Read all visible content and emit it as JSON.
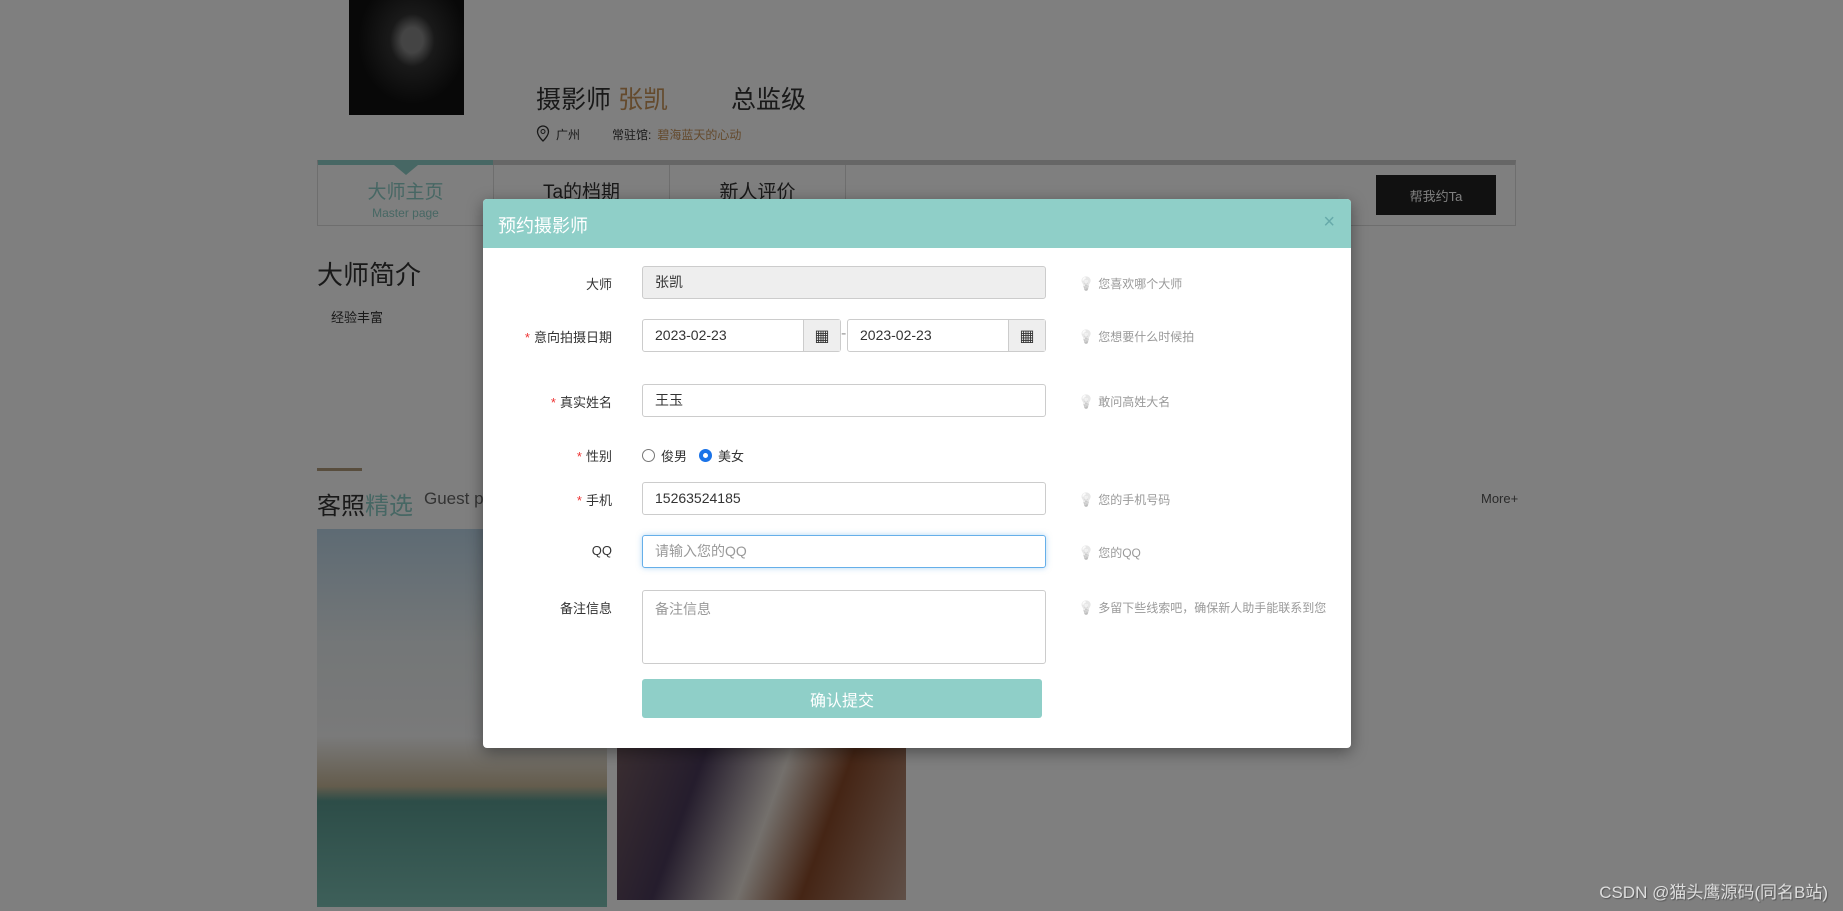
{
  "profile": {
    "title_prefix": "摄影师",
    "name": "张凯",
    "level": "总监级",
    "city": "广州",
    "studio_label": "常驻馆:",
    "studio": "碧海蓝天的心动"
  },
  "tabs": [
    {
      "label": "大师主页",
      "sub": "Master page"
    },
    {
      "label": "Ta的档期"
    },
    {
      "label": "新人评价"
    }
  ],
  "book_button": "帮我约Ta",
  "intro": {
    "title": "大师简介",
    "text": "经验丰富"
  },
  "guest": {
    "title_a": "客照",
    "title_b": "精选",
    "en": "Guest ph",
    "more": "More+"
  },
  "modal": {
    "title": "预约摄影师",
    "close": "×",
    "master": {
      "label": "大师",
      "value": "张凯",
      "hint": "您喜欢哪个大师"
    },
    "date": {
      "label": "意向拍摄日期",
      "from": "2023-02-23",
      "sep": "-",
      "to": "2023-02-23",
      "hint": "您想要什么时候拍"
    },
    "name": {
      "label": "真实姓名",
      "value": "王玉",
      "hint": "敢问高姓大名"
    },
    "gender": {
      "label": "性别",
      "options": [
        "俊男",
        "美女"
      ],
      "selected": "美女"
    },
    "phone": {
      "label": "手机",
      "value": "15263524185",
      "hint": "您的手机号码"
    },
    "qq": {
      "label": "QQ",
      "placeholder": "请输入您的QQ",
      "hint": "您的QQ"
    },
    "note": {
      "label": "备注信息",
      "placeholder": "备注信息",
      "hint": "多留下些线索吧，确保新人助手能联系到您"
    },
    "required_mark": "*",
    "submit": "确认提交"
  },
  "watermark": "CSDN @猫头鹰源码(同名B站)",
  "colors": {
    "accent": "#8fcfc8",
    "highlight": "#c8955a"
  }
}
